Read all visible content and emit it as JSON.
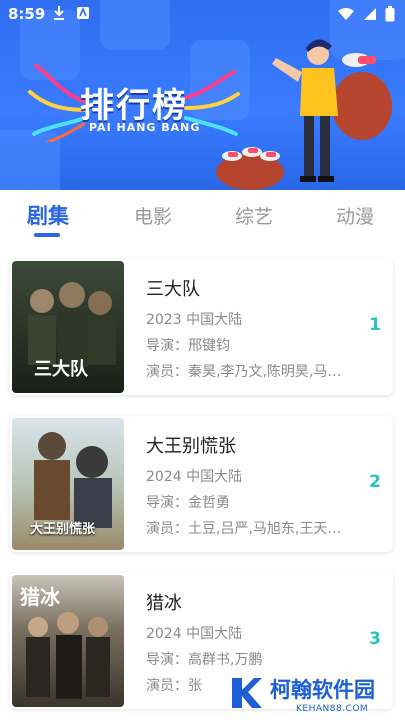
{
  "status_bar": {
    "time": "8:59"
  },
  "banner": {
    "title": "排行榜",
    "subtitle": "PAI HANG BANG"
  },
  "tabs": [
    {
      "label": "剧集",
      "active": true
    },
    {
      "label": "电影",
      "active": false
    },
    {
      "label": "综艺",
      "active": false
    },
    {
      "label": "动漫",
      "active": false
    }
  ],
  "items": [
    {
      "title": "三大队",
      "year_region": "2023 中国大陆",
      "director": "导演：邢键钧",
      "cast": "演员：秦昊,李乃文,陈明昊,马…",
      "rank": "1",
      "poster_text": "三大队"
    },
    {
      "title": "大王别慌张",
      "year_region": "2024 中国大陆",
      "director": "导演：金哲勇",
      "cast": "演员：土豆,吕严,马旭东,王天…",
      "rank": "2",
      "poster_text": "大王别慌张"
    },
    {
      "title": "猎冰",
      "year_region": "2024 中国大陆",
      "director": "导演：高群书,万鹏",
      "cast": "演员：张",
      "rank": "3",
      "poster_text": "猎冰"
    }
  ],
  "watermark": {
    "name": "柯翰软件园",
    "url": "KEHAN88.COM"
  },
  "colors": {
    "banner_blue": "#3a7bff",
    "active_tab": "#2b66e0",
    "rank": "#22c7b8"
  }
}
